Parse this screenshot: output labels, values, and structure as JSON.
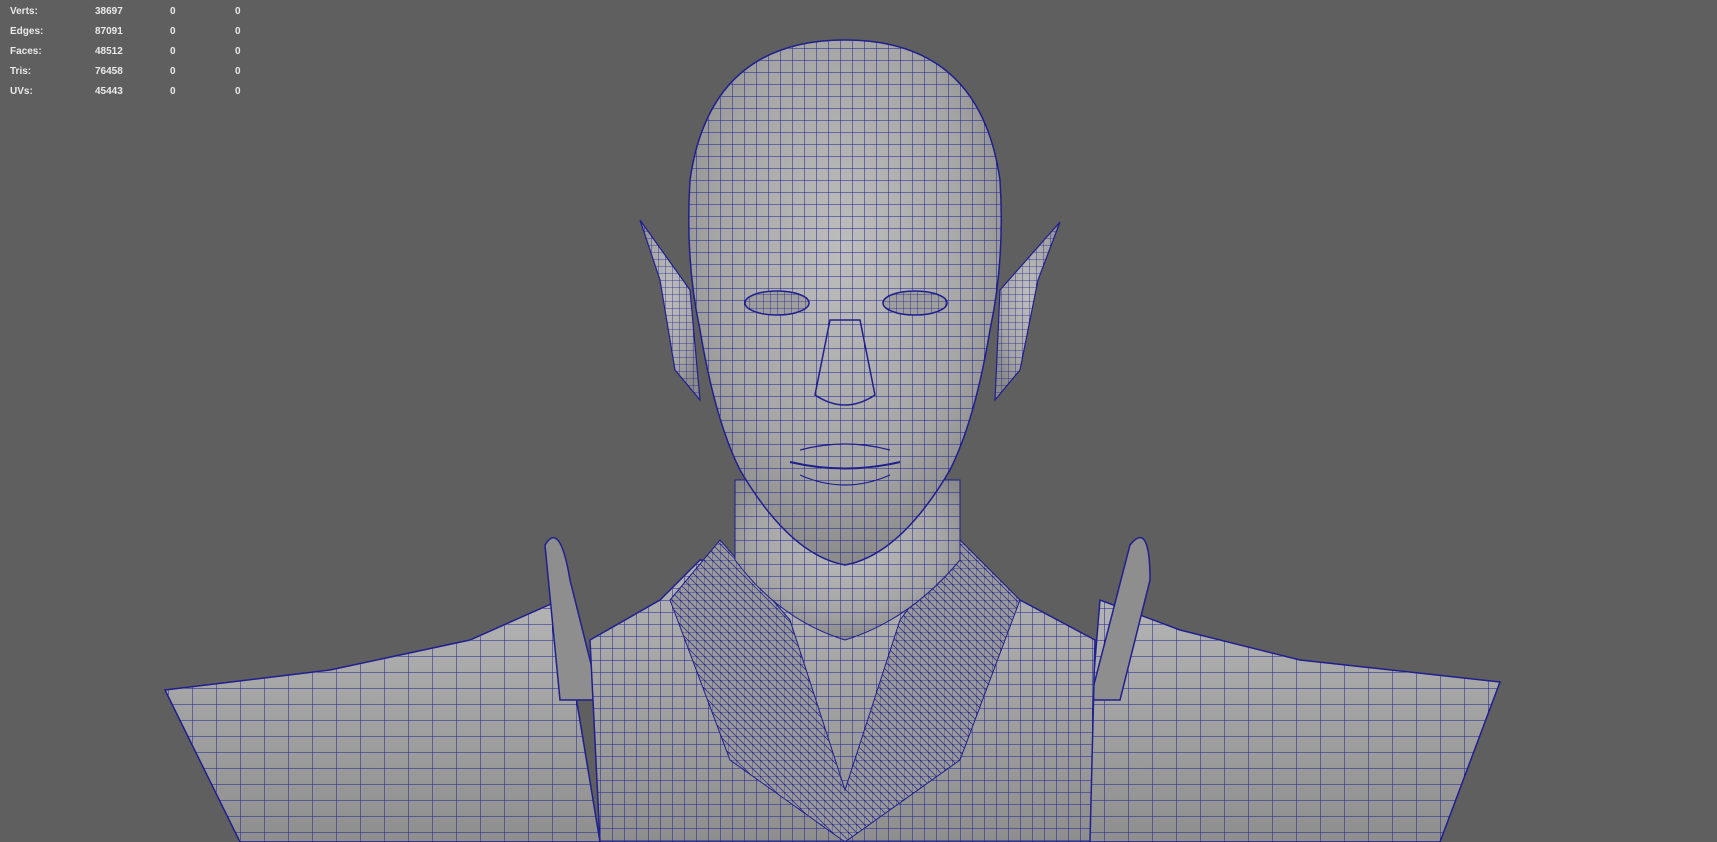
{
  "hud": {
    "rows": [
      {
        "label": "Verts:",
        "total": "38697",
        "selected": "0",
        "component": "0"
      },
      {
        "label": "Edges:",
        "total": "87091",
        "selected": "0",
        "component": "0"
      },
      {
        "label": "Faces:",
        "total": "48512",
        "selected": "0",
        "component": "0"
      },
      {
        "label": "Tris:",
        "total": "76458",
        "selected": "0",
        "component": "0"
      },
      {
        "label": "UVs:",
        "total": "45443",
        "selected": "0",
        "component": "0"
      }
    ]
  },
  "viewport": {
    "background_color": "#5f5f5f",
    "mesh_color": "#aaaaaa",
    "wire_color": "#1a1a8c",
    "display_mode": "wireframe-on-shaded",
    "model": "elf-character-bust"
  }
}
